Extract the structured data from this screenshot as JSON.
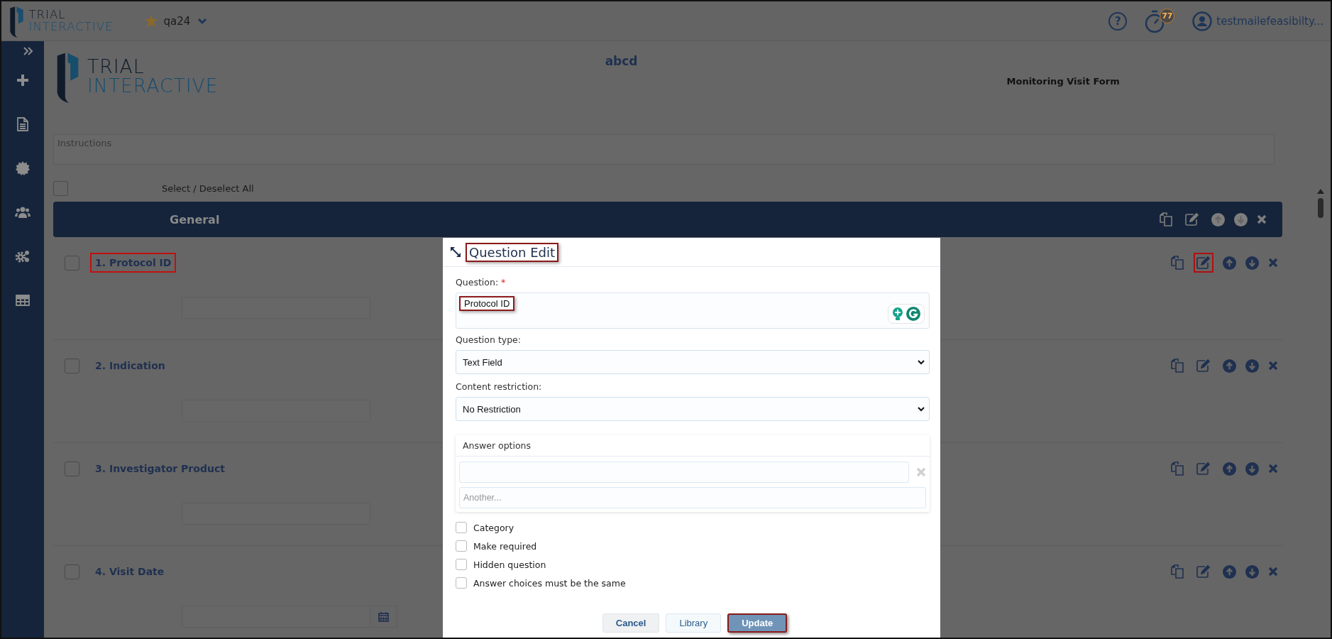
{
  "top_bar": {
    "logo": {
      "line1": "TRIAL",
      "line2": "INTERACTIVE"
    },
    "project": {
      "name": "qa24",
      "favorite": true
    },
    "help": {
      "glyph": "?"
    },
    "timer": {
      "badge": "77"
    },
    "user": {
      "name": "testmailefeasibilty..."
    }
  },
  "form": {
    "logo": {
      "line1": "TRIAL",
      "line2": "INTERACTIVE"
    },
    "title": "abcd",
    "subtitle": "Monitoring Visit Form",
    "instructions": {
      "placeholder": "Instructions"
    },
    "select_all": {
      "label": "Select / Deselect All",
      "checked": false
    },
    "section": {
      "title": "General"
    },
    "questions": [
      {
        "label": "1. Protocol ID",
        "kind": "text",
        "checked": false,
        "highlighted": true,
        "edit_highlighted": true
      },
      {
        "label": "2. Indication",
        "kind": "text",
        "checked": false,
        "highlighted": false,
        "edit_highlighted": false
      },
      {
        "label": "3. Investigator Product",
        "kind": "text",
        "checked": false,
        "highlighted": false,
        "edit_highlighted": false
      },
      {
        "label": "4. Visit Date",
        "kind": "date",
        "checked": false,
        "highlighted": false,
        "edit_highlighted": false
      }
    ]
  },
  "dialog": {
    "title": "Question Edit",
    "title_highlighted": true,
    "question_label": "Question:",
    "required_mark": "*",
    "question_value": "Protocol ID",
    "value_highlighted": true,
    "type_label": "Question type:",
    "type_value": "Text Field",
    "restriction_label": "Content restriction:",
    "restriction_value": "No Restriction",
    "answer_options": {
      "title": "Answer options",
      "another_placeholder": "Another..."
    },
    "checkboxes": [
      {
        "label": "Category",
        "checked": false
      },
      {
        "label": "Make required",
        "checked": false
      },
      {
        "label": "Hidden question",
        "checked": false
      },
      {
        "label": "Answer choices must be the same",
        "checked": false
      }
    ],
    "buttons": [
      {
        "label": "Cancel",
        "kind": "default",
        "highlighted": false
      },
      {
        "label": "Library",
        "kind": "light",
        "highlighted": false
      },
      {
        "label": "Update",
        "kind": "primary",
        "highlighted": true
      }
    ]
  }
}
